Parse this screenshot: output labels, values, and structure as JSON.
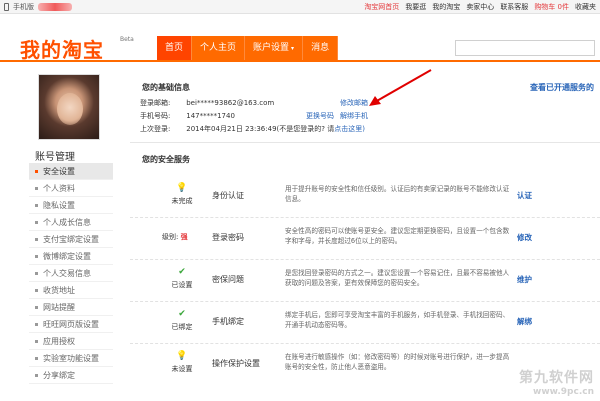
{
  "topbar": {
    "phone_label": "手机版",
    "right_links": [
      "淘宝网首页",
      "我要逛",
      "我的淘宝",
      "卖家中心",
      "联系客服",
      "购物车 0件",
      "收藏夹"
    ]
  },
  "header": {
    "logo": "我的淘宝",
    "beta": "Beta",
    "nav": [
      {
        "label": "首页",
        "active": true
      },
      {
        "label": "个人主页",
        "active": false
      },
      {
        "label": "账户设置",
        "caret": "▾",
        "active": false
      },
      {
        "label": "消息",
        "active": false
      }
    ]
  },
  "sidebar": {
    "title": "账号管理",
    "items": [
      {
        "label": "安全设置",
        "active": true
      },
      {
        "label": "个人资料"
      },
      {
        "label": "隐私设置"
      },
      {
        "label": "个人成长信息"
      },
      {
        "label": "支付宝绑定设置"
      },
      {
        "label": "微博绑定设置"
      },
      {
        "label": "个人交易信息"
      },
      {
        "label": "收货地址"
      },
      {
        "label": "网站提醒"
      },
      {
        "label": "旺旺网页版设置"
      },
      {
        "label": "应用授权"
      },
      {
        "label": "实验室功能设置"
      },
      {
        "label": "分享绑定"
      }
    ]
  },
  "basic": {
    "title": "您的基础信息",
    "view_all": "查看已开通服务的",
    "email_label": "登录邮箱:",
    "email_value": "bei*****93862@163.com",
    "email_link": "修改邮箱",
    "phone_label": "手机号码:",
    "phone_value": "147*****1740",
    "phone_link_change": "更换号码",
    "phone_link_unbind": "解绑手机",
    "last_login_label": "上次登录:",
    "last_login_value": "2014年04月21日 23:36:49(不是您登录的? 请",
    "last_login_link": "点击这里)"
  },
  "services": {
    "title": "您的安全服务",
    "rows": [
      {
        "status_icon": "bulb-icon",
        "status": "未完成",
        "name": "身份认证",
        "desc": "用于提升账号的安全性和信任级别。认证后的有卖家记录的账号不能修改认证信息。",
        "action": "认证"
      },
      {
        "level_label": "级别:",
        "level": "强",
        "name": "登录密码",
        "desc": "安全性高的密码可以使账号更安全。建议您定期更换密码，且设置一个包含数字和字母，并长度超过6位以上的密码。",
        "action": "修改"
      },
      {
        "status_icon": "check-icon",
        "status": "已设置",
        "name": "密保问题",
        "desc": "是您找回登录密码的方式之一。建议您设置一个容易记住，且最不容易被他人获取的问题及答案，更有效保障您的密码安全。",
        "action": "维护"
      },
      {
        "status_icon": "check-icon",
        "status": "已绑定",
        "name": "手机绑定",
        "desc": "绑定手机后，您即可享受淘宝丰富的手机服务，如手机登录、手机找回密码、开通手机动态密码等。",
        "action": "解绑"
      },
      {
        "status_icon": "bulb-icon",
        "status": "未设置",
        "name": "操作保护设置",
        "desc": "在账号进行敏感操作（如：修改密码等）的时候对账号进行保护，进一步提高账号的安全性，防止他人恶意盗用。",
        "action": ""
      }
    ]
  },
  "watermark": {
    "text": "第九软件网",
    "url": "www.9pc.cn"
  },
  "colors": {
    "brand": "#ff6a00",
    "link": "#2965b8",
    "danger": "#e4393c",
    "ok": "#3aa63a"
  }
}
